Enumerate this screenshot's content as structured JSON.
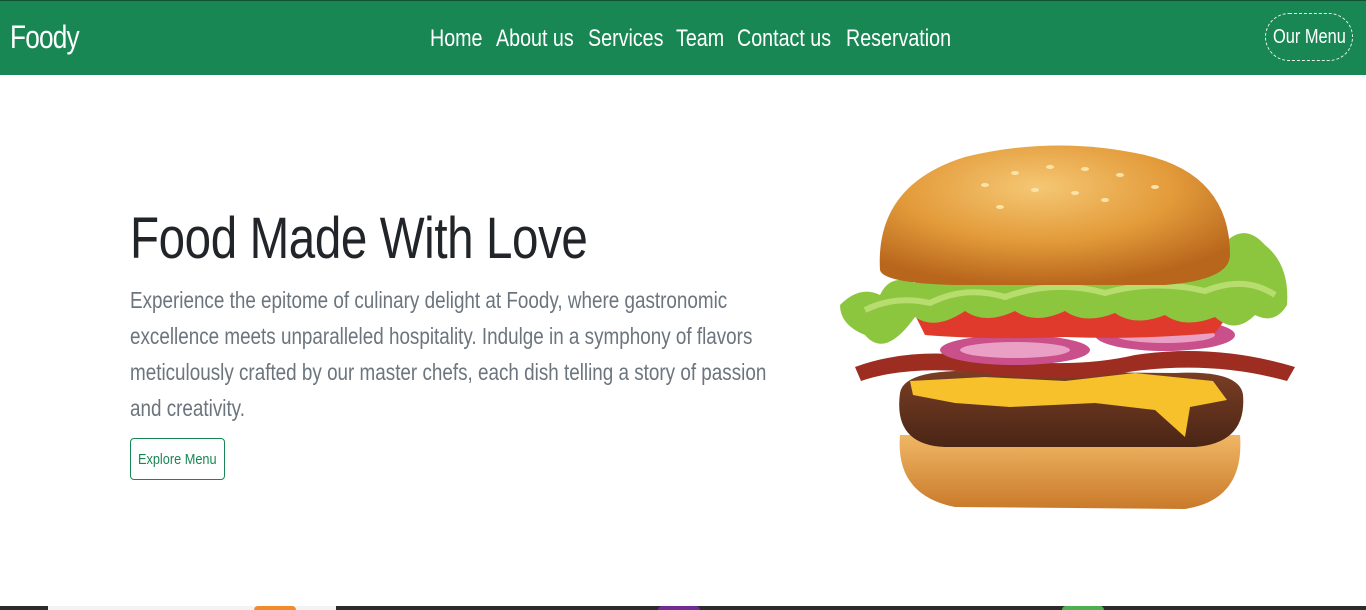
{
  "brand": "Foody",
  "nav": {
    "links": [
      "Home",
      "About us",
      "Services",
      "Team",
      "Contact us",
      "Reservation"
    ],
    "menu_button": "Our Menu"
  },
  "hero": {
    "title": "Food Made With Love",
    "text": "Experience the epitome of culinary delight at Foody, where gastronomic excellence meets unparalleled hospitality. Indulge in a symphony of flavors meticulously crafted by our master chefs, each dish telling a story of passion and creativity.",
    "button": "Explore Menu",
    "image": "burger-image"
  },
  "colors": {
    "primary": "#198754",
    "heading": "#212529",
    "muted": "#6c757d"
  }
}
